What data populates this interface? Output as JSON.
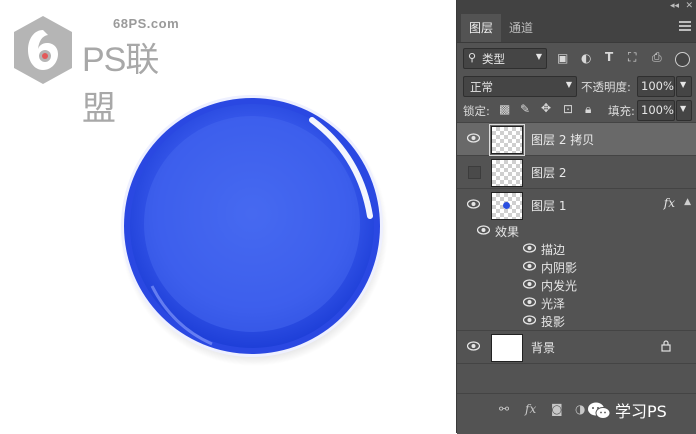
{
  "watermark": {
    "site": "68PS.com",
    "brand": "PS联盟"
  },
  "panel": {
    "tabs": [
      "图层",
      "通道"
    ],
    "filter": {
      "label": "类型",
      "icon": "search-icon"
    },
    "blend_mode": "正常",
    "opacity_label": "不透明度:",
    "opacity_value": "100%",
    "lock_label": "锁定:",
    "fill_label": "填充:",
    "fill_value": "100%",
    "layers": [
      {
        "name": "图层 2 拷贝",
        "visible": true,
        "selected": true,
        "thumb": "transparent"
      },
      {
        "name": "图层 2",
        "visible": false,
        "selected": false,
        "thumb": "transparent"
      },
      {
        "name": "图层 1",
        "visible": true,
        "selected": false,
        "thumb": "dot",
        "fx": "fx"
      },
      {
        "name": "背景",
        "visible": true,
        "selected": false,
        "thumb": "white",
        "locked": true
      }
    ],
    "effects_label": "效果",
    "effects": [
      "描边",
      "内阴影",
      "内发光",
      "光泽",
      "投影"
    ],
    "wechat_label": "学习PS"
  },
  "colors": {
    "sphere": "#2f4fe8",
    "panel_bg": "#535353",
    "selected_row": "#696969"
  }
}
